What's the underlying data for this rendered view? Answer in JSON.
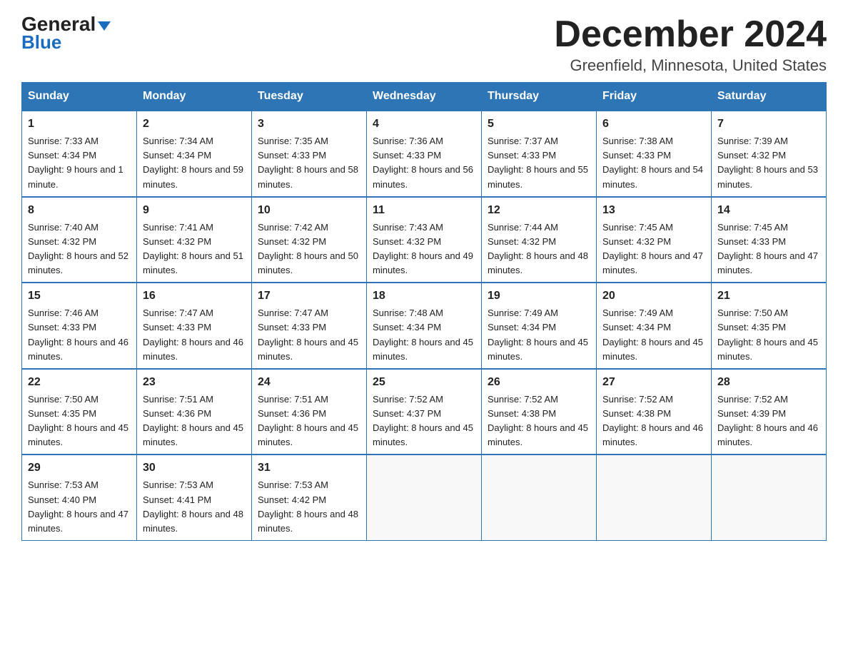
{
  "logo": {
    "text_general": "General",
    "text_blue": "Blue"
  },
  "title": {
    "month_year": "December 2024",
    "location": "Greenfield, Minnesota, United States"
  },
  "days_of_week": [
    "Sunday",
    "Monday",
    "Tuesday",
    "Wednesday",
    "Thursday",
    "Friday",
    "Saturday"
  ],
  "weeks": [
    [
      {
        "day": "1",
        "sunrise": "7:33 AM",
        "sunset": "4:34 PM",
        "daylight": "9 hours and 1 minute."
      },
      {
        "day": "2",
        "sunrise": "7:34 AM",
        "sunset": "4:34 PM",
        "daylight": "8 hours and 59 minutes."
      },
      {
        "day": "3",
        "sunrise": "7:35 AM",
        "sunset": "4:33 PM",
        "daylight": "8 hours and 58 minutes."
      },
      {
        "day": "4",
        "sunrise": "7:36 AM",
        "sunset": "4:33 PM",
        "daylight": "8 hours and 56 minutes."
      },
      {
        "day": "5",
        "sunrise": "7:37 AM",
        "sunset": "4:33 PM",
        "daylight": "8 hours and 55 minutes."
      },
      {
        "day": "6",
        "sunrise": "7:38 AM",
        "sunset": "4:33 PM",
        "daylight": "8 hours and 54 minutes."
      },
      {
        "day": "7",
        "sunrise": "7:39 AM",
        "sunset": "4:32 PM",
        "daylight": "8 hours and 53 minutes."
      }
    ],
    [
      {
        "day": "8",
        "sunrise": "7:40 AM",
        "sunset": "4:32 PM",
        "daylight": "8 hours and 52 minutes."
      },
      {
        "day": "9",
        "sunrise": "7:41 AM",
        "sunset": "4:32 PM",
        "daylight": "8 hours and 51 minutes."
      },
      {
        "day": "10",
        "sunrise": "7:42 AM",
        "sunset": "4:32 PM",
        "daylight": "8 hours and 50 minutes."
      },
      {
        "day": "11",
        "sunrise": "7:43 AM",
        "sunset": "4:32 PM",
        "daylight": "8 hours and 49 minutes."
      },
      {
        "day": "12",
        "sunrise": "7:44 AM",
        "sunset": "4:32 PM",
        "daylight": "8 hours and 48 minutes."
      },
      {
        "day": "13",
        "sunrise": "7:45 AM",
        "sunset": "4:32 PM",
        "daylight": "8 hours and 47 minutes."
      },
      {
        "day": "14",
        "sunrise": "7:45 AM",
        "sunset": "4:33 PM",
        "daylight": "8 hours and 47 minutes."
      }
    ],
    [
      {
        "day": "15",
        "sunrise": "7:46 AM",
        "sunset": "4:33 PM",
        "daylight": "8 hours and 46 minutes."
      },
      {
        "day": "16",
        "sunrise": "7:47 AM",
        "sunset": "4:33 PM",
        "daylight": "8 hours and 46 minutes."
      },
      {
        "day": "17",
        "sunrise": "7:47 AM",
        "sunset": "4:33 PM",
        "daylight": "8 hours and 45 minutes."
      },
      {
        "day": "18",
        "sunrise": "7:48 AM",
        "sunset": "4:34 PM",
        "daylight": "8 hours and 45 minutes."
      },
      {
        "day": "19",
        "sunrise": "7:49 AM",
        "sunset": "4:34 PM",
        "daylight": "8 hours and 45 minutes."
      },
      {
        "day": "20",
        "sunrise": "7:49 AM",
        "sunset": "4:34 PM",
        "daylight": "8 hours and 45 minutes."
      },
      {
        "day": "21",
        "sunrise": "7:50 AM",
        "sunset": "4:35 PM",
        "daylight": "8 hours and 45 minutes."
      }
    ],
    [
      {
        "day": "22",
        "sunrise": "7:50 AM",
        "sunset": "4:35 PM",
        "daylight": "8 hours and 45 minutes."
      },
      {
        "day": "23",
        "sunrise": "7:51 AM",
        "sunset": "4:36 PM",
        "daylight": "8 hours and 45 minutes."
      },
      {
        "day": "24",
        "sunrise": "7:51 AM",
        "sunset": "4:36 PM",
        "daylight": "8 hours and 45 minutes."
      },
      {
        "day": "25",
        "sunrise": "7:52 AM",
        "sunset": "4:37 PM",
        "daylight": "8 hours and 45 minutes."
      },
      {
        "day": "26",
        "sunrise": "7:52 AM",
        "sunset": "4:38 PM",
        "daylight": "8 hours and 45 minutes."
      },
      {
        "day": "27",
        "sunrise": "7:52 AM",
        "sunset": "4:38 PM",
        "daylight": "8 hours and 46 minutes."
      },
      {
        "day": "28",
        "sunrise": "7:52 AM",
        "sunset": "4:39 PM",
        "daylight": "8 hours and 46 minutes."
      }
    ],
    [
      {
        "day": "29",
        "sunrise": "7:53 AM",
        "sunset": "4:40 PM",
        "daylight": "8 hours and 47 minutes."
      },
      {
        "day": "30",
        "sunrise": "7:53 AM",
        "sunset": "4:41 PM",
        "daylight": "8 hours and 48 minutes."
      },
      {
        "day": "31",
        "sunrise": "7:53 AM",
        "sunset": "4:42 PM",
        "daylight": "8 hours and 48 minutes."
      },
      null,
      null,
      null,
      null
    ]
  ]
}
